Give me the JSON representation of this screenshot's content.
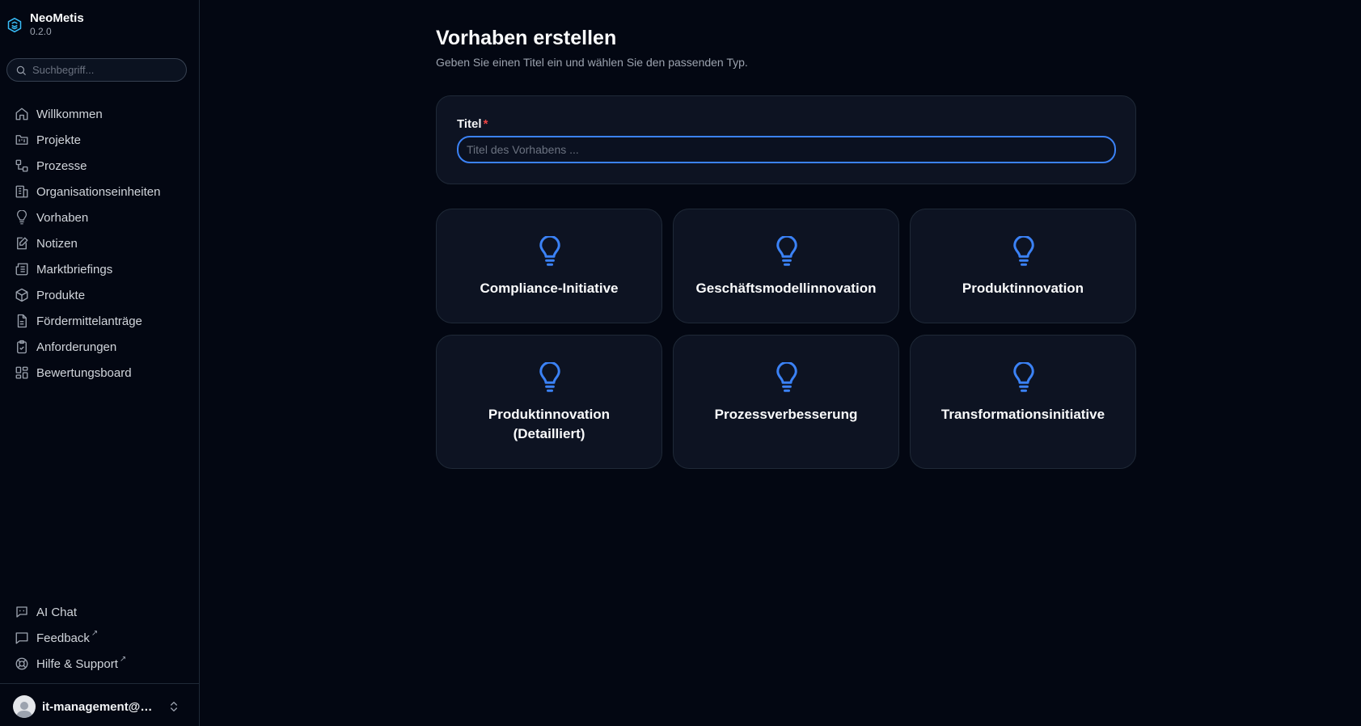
{
  "app": {
    "name": "NeoMetis",
    "version": "0.2.0"
  },
  "search": {
    "placeholder": "Suchbegriff..."
  },
  "sidebar": {
    "items": [
      {
        "label": "Willkommen",
        "icon": "home-icon"
      },
      {
        "label": "Projekte",
        "icon": "folder-kanban-icon"
      },
      {
        "label": "Prozesse",
        "icon": "workflow-icon"
      },
      {
        "label": "Organisationseinheiten",
        "icon": "building-icon"
      },
      {
        "label": "Vorhaben",
        "icon": "lightbulb-icon"
      },
      {
        "label": "Notizen",
        "icon": "notebook-pen-icon"
      },
      {
        "label": "Marktbriefings",
        "icon": "newspaper-icon"
      },
      {
        "label": "Produkte",
        "icon": "package-icon"
      },
      {
        "label": "Fördermittelanträge",
        "icon": "file-text-icon"
      },
      {
        "label": "Anforderungen",
        "icon": "clipboard-check-icon"
      },
      {
        "label": "Bewertungsboard",
        "icon": "layout-dashboard-icon"
      }
    ],
    "bottom": [
      {
        "label": "AI Chat",
        "icon": "bot-message-icon"
      },
      {
        "label": "Feedback",
        "icon": "message-square-icon",
        "external": "↗"
      },
      {
        "label": "Hilfe & Support",
        "icon": "life-buoy-icon",
        "external": "↗"
      }
    ]
  },
  "user": {
    "name": "it-management@oly..."
  },
  "page": {
    "title": "Vorhaben erstellen",
    "subtitle": "Geben Sie einen Titel ein und wählen Sie den passenden Typ."
  },
  "form": {
    "title_label": "Titel",
    "required_mark": "*",
    "title_placeholder": "Titel des Vorhabens ...",
    "title_value": ""
  },
  "types": [
    {
      "label": "Compliance-Initiative",
      "icon": "lightbulb-icon"
    },
    {
      "label": "Geschäftsmodellinnovation",
      "icon": "lightbulb-icon"
    },
    {
      "label": "Produktinnovation",
      "icon": "lightbulb-icon"
    },
    {
      "label": "Produktinnovation (Detailliert)",
      "icon": "lightbulb-icon"
    },
    {
      "label": "Prozessverbesserung",
      "icon": "lightbulb-icon"
    },
    {
      "label": "Transformationsinitiative",
      "icon": "lightbulb-icon"
    }
  ],
  "colors": {
    "accent": "#3b82f6",
    "background": "#030712",
    "card": "#0d1322",
    "brand": "#38bdf8",
    "required": "#ef4444"
  }
}
